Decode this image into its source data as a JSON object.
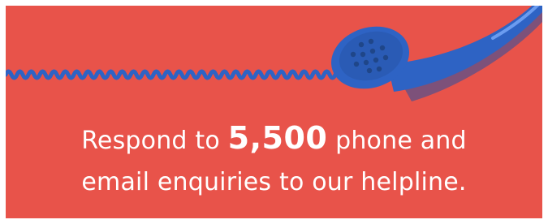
{
  "message": {
    "line1_before": "Respond to ",
    "highlight": "5,500",
    "line1_after": " phone and",
    "line2": "email enquiries to our helpline."
  },
  "colors": {
    "background": "#e8534a",
    "phone": "#2e63c4",
    "text": "#ffffff"
  },
  "icons": [
    "telephone-handset-icon",
    "coiled-cord-icon"
  ]
}
